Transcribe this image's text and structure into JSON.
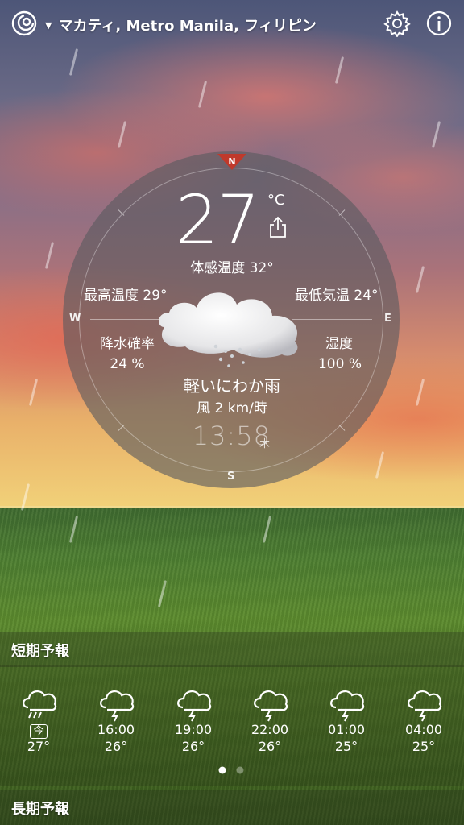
{
  "header": {
    "location": "マカティ, Metro Manila, フィリピン",
    "app_icon": "spiral-logo-icon",
    "settings_icon": "gear-icon",
    "info_icon": "info-icon"
  },
  "current": {
    "temperature": "27",
    "unit": "°C",
    "feels_like": "体感温度 32°",
    "high": "最高温度 29°",
    "low": "最低気温 24°",
    "precip_label": "降水確率",
    "precip_value": "24 %",
    "humidity_label": "湿度",
    "humidity_value": "100 %",
    "condition": "軽いにわか雨",
    "wind": "風 2 km/時",
    "time": "13:58",
    "weekday": "木",
    "weather_icon": "rain-cloud-icon"
  },
  "compass": {
    "north": "N",
    "south": "S",
    "east": "E",
    "west": "W"
  },
  "short_forecast": {
    "title": "短期予報",
    "now_badge": "今",
    "hours": [
      {
        "time": "",
        "temp": "27°",
        "icon": "rain-cloud-icon"
      },
      {
        "time": "16:00",
        "temp": "26°",
        "icon": "thunder-cloud-icon"
      },
      {
        "time": "19:00",
        "temp": "26°",
        "icon": "thunder-cloud-icon"
      },
      {
        "time": "22:00",
        "temp": "26°",
        "icon": "thunder-cloud-icon"
      },
      {
        "time": "01:00",
        "temp": "25°",
        "icon": "thunder-cloud-icon"
      },
      {
        "time": "04:00",
        "temp": "25°",
        "icon": "thunder-cloud-icon"
      }
    ],
    "page_count": 2,
    "current_page": 1
  },
  "long_forecast": {
    "title": "長期予報"
  },
  "colors": {
    "compass_north": "#c0392b",
    "dial": "#5a5a5f"
  }
}
